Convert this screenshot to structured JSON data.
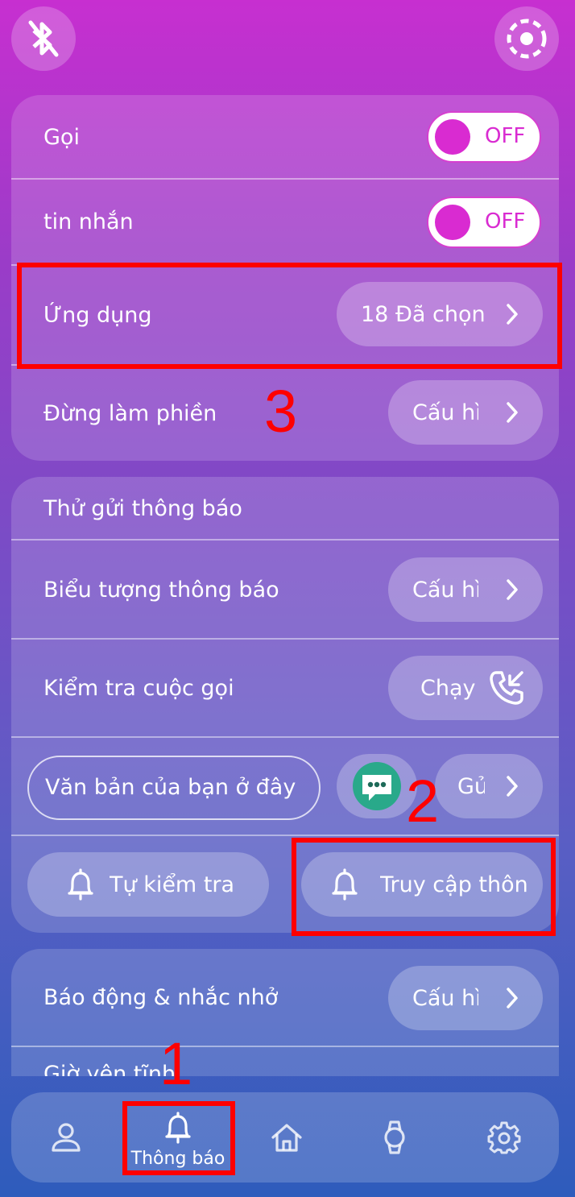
{
  "top": {
    "left_icon": "bluetooth-off-icon",
    "right_icon": "dashed-circle-icon"
  },
  "card1": {
    "call_label": "Gọi",
    "call_toggle": "OFF",
    "message_label": "tin nhắn",
    "message_toggle": "OFF",
    "apps_label": "Ứng dụng",
    "apps_value": "18 Đã chọn",
    "dnd_label": "Đừng làm phiền",
    "dnd_value": "Cấu hì"
  },
  "card2": {
    "test_notification_label": "Thử gửi thông báo",
    "notification_icon_label": "Biểu tượng thông báo",
    "notification_icon_value": "Cấu hì",
    "call_test_label": "Kiểm tra cuộc gọi",
    "call_test_value": "Chạy",
    "text_input_placeholder": "Văn bản của bạn ở đây",
    "send_value": "Gử",
    "self_test_label": "Tự kiểm tra",
    "access_label": "Truy cập thôn"
  },
  "card3": {
    "alarm_label": "Báo động & nhắc nhở",
    "alarm_value": "Cấu hì",
    "quiet_label": "Giờ yên tĩnh"
  },
  "nav": {
    "notifications_label": "Thông báo",
    "items": [
      "profile-icon",
      "bell-icon",
      "home-icon",
      "watch-icon",
      "gear-icon"
    ]
  },
  "annotations": {
    "n1": "1",
    "n2": "2",
    "n3": "3"
  },
  "colors": {
    "accent": "#d92bd1",
    "highlight": "#ff0000"
  }
}
